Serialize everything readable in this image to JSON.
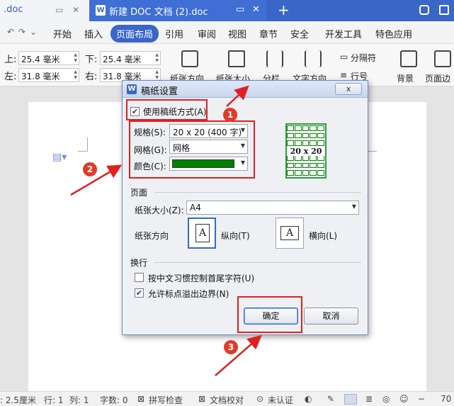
{
  "titlebar": {
    "tab1_name": ".doc",
    "tab2_logo": "W",
    "tab2_name": "新建 DOC 文档 (2).doc",
    "new_tab": "+"
  },
  "menubar": {
    "items": [
      "开始",
      "插入",
      "页面布局",
      "引用",
      "审阅",
      "视图",
      "章节",
      "安全",
      "开发工具",
      "特色应用"
    ],
    "active": "页面布局"
  },
  "toolbar": {
    "top_label": "上:",
    "top_value": "25.4 毫米",
    "bottom_label": "下:",
    "bottom_value": "25.4 毫米",
    "left_label": "左:",
    "left_value": "31.8 毫米",
    "right_label": "右:",
    "right_value": "31.8 毫米",
    "paper_orientation": "纸张方向",
    "paper_size": "纸张大小",
    "columns": "分栏",
    "text_direction": "文字方向",
    "separator": "分隔符",
    "line_number": "行号",
    "background": "背景",
    "page_border": "页面边框"
  },
  "dialog": {
    "title": "稿纸设置",
    "logo": "W",
    "close": "x",
    "use_grid_paper_label": "使用稿纸方式(A)",
    "use_grid_paper_checked": true,
    "spec_label": "规格(S):",
    "spec_value": "20 x 20 (400 字)",
    "grid_label": "网格(G):",
    "grid_value": "网格",
    "color_label": "颜色(C):",
    "color_value": "#008000",
    "preview_text": "20 x 20",
    "page_section": "页面",
    "paper_size_label": "纸张大小(Z):",
    "paper_size_value": "A4",
    "paper_orientation_label": "纸张方向",
    "portrait_label": "纵向(T)",
    "landscape_label": "横向(L)",
    "orient_glyph": "A",
    "linebreak_section": "换行",
    "cjk_rules_label": "按中文习惯控制首尾字符(U)",
    "cjk_rules_checked": false,
    "allow_overflow_label": "允许标点溢出边界(N)",
    "allow_overflow_checked": true,
    "ok_label": "确定",
    "cancel_label": "取消"
  },
  "annotations": {
    "badge1": "1",
    "badge2": "2",
    "badge3": "3",
    "color": "#e02020"
  },
  "statusbar": {
    "position": ": 2.5厘米",
    "line": "行: 1",
    "col": "列: 1",
    "words": "字数: 0",
    "spellcheck": "拼写检查",
    "proofread": "文档校对",
    "uncertified": "未认证",
    "zoom": "70"
  },
  "colors": {
    "accent": "#3a66c8",
    "grid_green": "#008000"
  }
}
